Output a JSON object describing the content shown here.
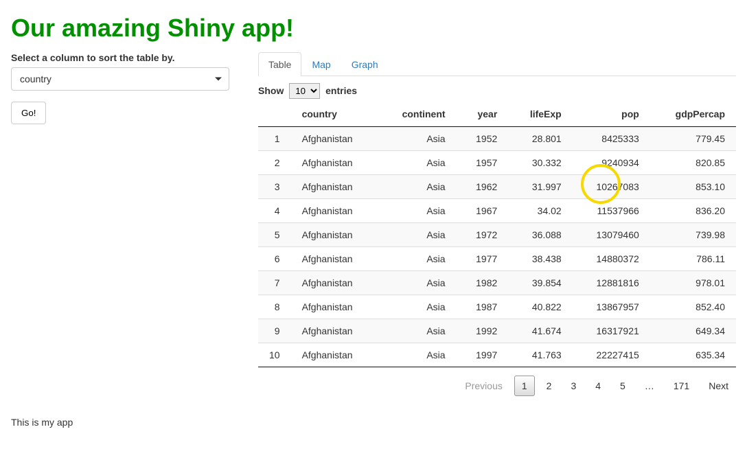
{
  "header": {
    "title": "Our amazing Shiny app!"
  },
  "sidebar": {
    "label": "Select a column to sort the table by.",
    "select_value": "country",
    "go_label": "Go!",
    "footer_text": "This is my app"
  },
  "tabs": [
    {
      "label": "Table",
      "active": true
    },
    {
      "label": "Map",
      "active": false
    },
    {
      "label": "Graph",
      "active": false
    }
  ],
  "length_menu": {
    "show": "Show",
    "entries": "entries",
    "value": "10"
  },
  "columns": [
    "country",
    "continent",
    "year",
    "lifeExp",
    "pop",
    "gdpPercap"
  ],
  "rows": [
    {
      "idx": 1,
      "country": "Afghanistan",
      "continent": "Asia",
      "year": 1952,
      "lifeExp": "28.801",
      "pop": "8425333",
      "gdpPercap": "779.45"
    },
    {
      "idx": 2,
      "country": "Afghanistan",
      "continent": "Asia",
      "year": 1957,
      "lifeExp": "30.332",
      "pop": "9240934",
      "gdpPercap": "820.85"
    },
    {
      "idx": 3,
      "country": "Afghanistan",
      "continent": "Asia",
      "year": 1962,
      "lifeExp": "31.997",
      "pop": "10267083",
      "gdpPercap": "853.10"
    },
    {
      "idx": 4,
      "country": "Afghanistan",
      "continent": "Asia",
      "year": 1967,
      "lifeExp": "34.02",
      "pop": "11537966",
      "gdpPercap": "836.20"
    },
    {
      "idx": 5,
      "country": "Afghanistan",
      "continent": "Asia",
      "year": 1972,
      "lifeExp": "36.088",
      "pop": "13079460",
      "gdpPercap": "739.98"
    },
    {
      "idx": 6,
      "country": "Afghanistan",
      "continent": "Asia",
      "year": 1977,
      "lifeExp": "38.438",
      "pop": "14880372",
      "gdpPercap": "786.11"
    },
    {
      "idx": 7,
      "country": "Afghanistan",
      "continent": "Asia",
      "year": 1982,
      "lifeExp": "39.854",
      "pop": "12881816",
      "gdpPercap": "978.01"
    },
    {
      "idx": 8,
      "country": "Afghanistan",
      "continent": "Asia",
      "year": 1987,
      "lifeExp": "40.822",
      "pop": "13867957",
      "gdpPercap": "852.40"
    },
    {
      "idx": 9,
      "country": "Afghanistan",
      "continent": "Asia",
      "year": 1992,
      "lifeExp": "41.674",
      "pop": "16317921",
      "gdpPercap": "649.34"
    },
    {
      "idx": 10,
      "country": "Afghanistan",
      "continent": "Asia",
      "year": 1997,
      "lifeExp": "41.763",
      "pop": "22227415",
      "gdpPercap": "635.34"
    }
  ],
  "pagination": {
    "previous": "Previous",
    "next": "Next",
    "pages": [
      "1",
      "2",
      "3",
      "4",
      "5",
      "…",
      "171"
    ],
    "current": "1"
  },
  "highlight": {
    "row_index": 2,
    "col_key": "pop"
  }
}
